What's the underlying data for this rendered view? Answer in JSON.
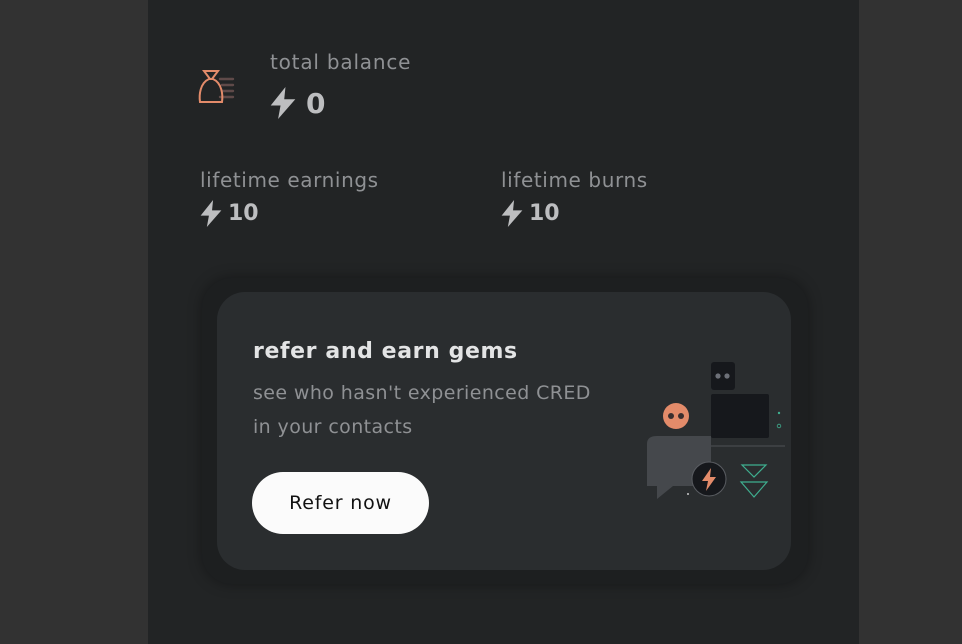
{
  "balance": {
    "label": "total balance",
    "value": "0",
    "icon": "money-bag-icon"
  },
  "stats": {
    "earnings": {
      "label": "lifetime earnings",
      "value": "10"
    },
    "burns": {
      "label": "lifetime burns",
      "value": "10"
    }
  },
  "refer_card": {
    "title": "refer and earn gems",
    "description_line1": "see who hasn't experienced CRED",
    "description_line2": "in your contacts",
    "button_label": "Refer now",
    "illustration": "referral-people-illustration"
  },
  "colors": {
    "page_bg": "#323232",
    "panel_bg": "#222425",
    "card_bg": "#2a2d2f",
    "accent_orange": "#e38b6a",
    "accent_teal": "#3fae8f",
    "button_bg": "#fbfbfb"
  }
}
